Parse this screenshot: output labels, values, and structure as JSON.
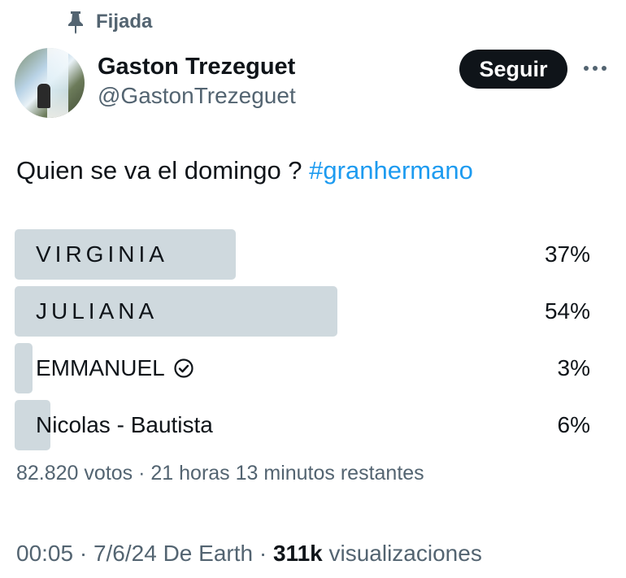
{
  "pinned": {
    "label": "Fijada",
    "icon": "pin-icon"
  },
  "author": {
    "name": "Gaston Trezeguet",
    "handle": "@GastonTrezeguet",
    "follow_label": "Seguir",
    "more_icon": "more-icon"
  },
  "tweet": {
    "text": "Quien se va el domingo ? ",
    "hashtag": "#granhermano"
  },
  "poll": {
    "options": [
      {
        "label": "VIRGINIA",
        "percent": "37%",
        "fraction": 0.37
      },
      {
        "label": "JULIANA",
        "percent": "54%",
        "fraction": 0.54
      },
      {
        "label": "EMMANUEL",
        "percent": "3%",
        "fraction": 0.03,
        "selected": true
      },
      {
        "label": "Nicolas - Bautista",
        "percent": "6%",
        "fraction": 0.06
      }
    ],
    "meta": "82.820 votos · 21 horas 13 minutos restantes"
  },
  "footer": {
    "time_date": "00:05 · 7/6/24 De Earth · ",
    "views_count": "311k",
    "views_label": " visualizaciones"
  },
  "colors": {
    "text": "#0f1419",
    "secondary": "#536471",
    "link": "#1d9bf0",
    "poll_bar": "#cfd9de",
    "button_bg": "#0f1419"
  }
}
